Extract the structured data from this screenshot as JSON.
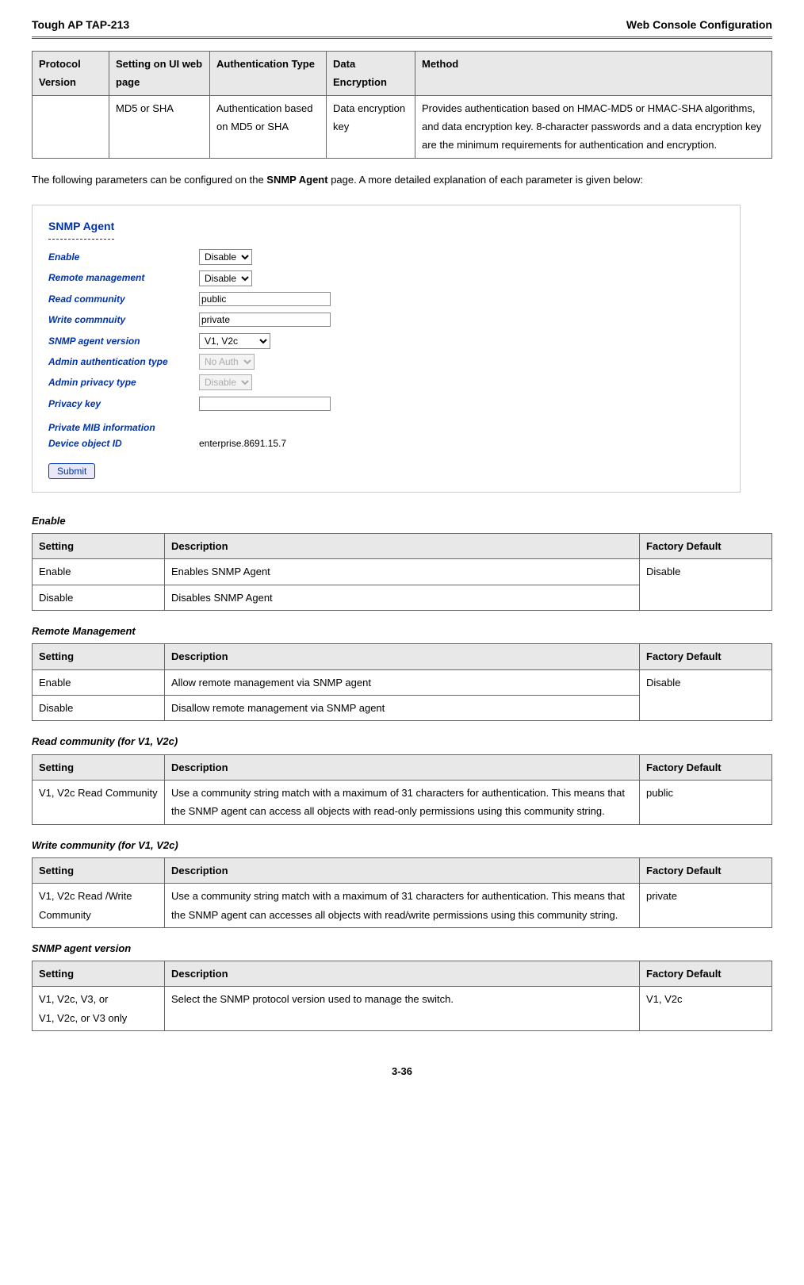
{
  "header": {
    "left": "Tough AP TAP-213",
    "right": "Web Console Configuration"
  },
  "protocol_table": {
    "headers": [
      "Protocol Version",
      "Setting on UI web page",
      "Authentication Type",
      "Data Encryption",
      "Method"
    ],
    "row": {
      "c0": "",
      "c1": "MD5 or SHA",
      "c2": "Authentication based on MD5 or SHA",
      "c3": "Data encryption key",
      "c4": "Provides authentication based on HMAC-MD5 or HMAC-SHA algorithms, and data encryption key. 8-character passwords and a data encryption key are the minimum requirements for authentication and encryption."
    }
  },
  "intro": {
    "pre": "The following parameters can be configured on the ",
    "bold": "SNMP Agent",
    "post": " page. A more detailed explanation of each parameter is given below:"
  },
  "snmp_form": {
    "title": "SNMP Agent",
    "labels": {
      "enable": "Enable",
      "remote": "Remote management",
      "read": "Read community",
      "write": "Write commnuity",
      "version": "SNMP agent version",
      "auth": "Admin authentication type",
      "priv": "Admin privacy type",
      "privkey": "Privacy key",
      "mib": "Private MIB information",
      "devid": "Device object ID"
    },
    "values": {
      "enable": "Disable",
      "remote": "Disable",
      "read": "public",
      "write": "private",
      "version": "V1, V2c",
      "auth": "No Auth",
      "priv": "Disable",
      "privkey": "",
      "devid": "enterprise.8691.15.7"
    },
    "submit": "Submit"
  },
  "sections": {
    "enable": {
      "title": "Enable",
      "headers": [
        "Setting",
        "Description",
        "Factory Default"
      ],
      "rows": [
        {
          "s": "Enable",
          "d": "Enables SNMP Agent",
          "f": "Disable"
        },
        {
          "s": "Disable",
          "d": "Disables SNMP Agent",
          "f": ""
        }
      ]
    },
    "remote": {
      "title": "Remote Management",
      "headers": [
        "Setting",
        "Description",
        "Factory Default"
      ],
      "rows": [
        {
          "s": "Enable",
          "d": "Allow remote management via SNMP agent",
          "f": "Disable"
        },
        {
          "s": "Disable",
          "d": "Disallow remote management via SNMP agent",
          "f": ""
        }
      ]
    },
    "read": {
      "title": "Read community (for V1, V2c)",
      "headers": [
        "Setting",
        "Description",
        "Factory Default"
      ],
      "rows": [
        {
          "s": "V1, V2c Read Community",
          "d": "Use a community string match with a maximum of 31 characters for authentication. This means that the SNMP agent can access all objects with read-only permissions using this community string.",
          "f": "public"
        }
      ]
    },
    "write": {
      "title": "Write community (for V1, V2c)",
      "headers": [
        "Setting",
        "Description",
        "Factory Default"
      ],
      "rows": [
        {
          "s": "V1, V2c Read /Write Community",
          "d": "Use a community string match with a maximum of 31 characters for authentication. This means that the SNMP agent can accesses all objects with read/write permissions using this community string.",
          "f": "private"
        }
      ]
    },
    "version": {
      "title": "SNMP agent version",
      "headers": [
        "Setting",
        "Description",
        "Factory Default"
      ],
      "rows": [
        {
          "s": "V1, V2c, V3, or\nV1, V2c, or V3 only",
          "d": "Select the SNMP protocol version used to manage the switch.",
          "f": "V1, V2c"
        }
      ]
    }
  },
  "page_number": "3-36"
}
